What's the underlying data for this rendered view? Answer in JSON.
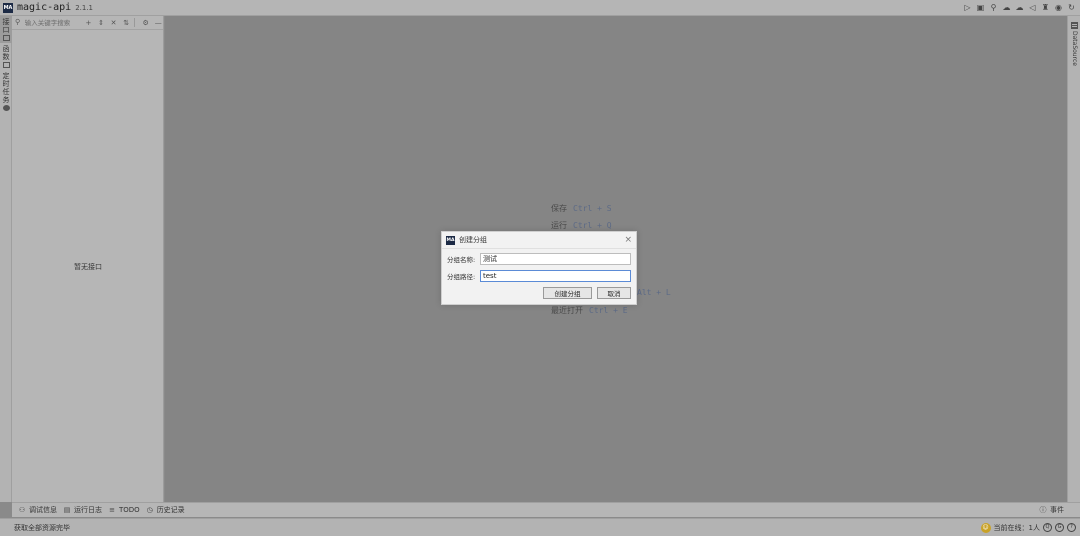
{
  "titlebar": {
    "logo_text": "MA",
    "app_name": "magic-api",
    "version": "2.1.1",
    "icons": [
      "run-icon",
      "save-icon",
      "search-icon",
      "download-icon",
      "upload-icon",
      "push-icon",
      "skin-icon",
      "github-icon",
      "refresh-icon"
    ]
  },
  "left_strip": {
    "tabs": [
      {
        "label": "接口",
        "icon": "api-icon",
        "active": true
      },
      {
        "label": "函数",
        "icon": "function-icon",
        "active": false
      },
      {
        "label": "定时任务",
        "icon": "clock-icon",
        "active": false
      }
    ]
  },
  "left_panel": {
    "search_placeholder": "输入关键字搜索",
    "tools": [
      "add-group-icon",
      "expand-collapse-icon",
      "close-all-icon",
      "sort-icon",
      "settings-icon",
      "more-icon"
    ],
    "empty_text": "暂无接口"
  },
  "main": {
    "shortcuts": [
      {
        "label": "保存",
        "keys": "Ctrl + S"
      },
      {
        "label": "运行",
        "keys": "Ctrl + Q"
      },
      {
        "label": "",
        "keys": "Alt + L"
      },
      {
        "label": "最近打开",
        "keys": "Ctrl + E"
      }
    ]
  },
  "right_strip": {
    "tab_label": "DataSource",
    "tab_icon": "database-icon"
  },
  "bottom_toolbar": {
    "items": [
      {
        "label": "调试信息",
        "icon": "bug-icon"
      },
      {
        "label": "运行日志",
        "icon": "log-icon"
      },
      {
        "label": "TODO",
        "icon": "list-icon"
      },
      {
        "label": "历史记录",
        "icon": "history-icon"
      }
    ],
    "right_item": {
      "label": "事件",
      "icon": "event-icon"
    }
  },
  "statusbar": {
    "text": "获取全部资源完毕",
    "online_label": "当前在线：1人",
    "icons": [
      "qq-icon",
      "github-icon",
      "help-icon"
    ]
  },
  "dialog": {
    "logo_text": "MA",
    "title": "创建分组",
    "close_glyph": "×",
    "fields": [
      {
        "label": "分组名称:",
        "value": "测试"
      },
      {
        "label": "分组路径:",
        "value": "test"
      }
    ],
    "confirm_label": "创建分组",
    "cancel_label": "取消"
  },
  "colors": {
    "accent": "#5b8bd6",
    "logo": "#1c2a45",
    "shortcut_keys": "#5c6a86"
  }
}
